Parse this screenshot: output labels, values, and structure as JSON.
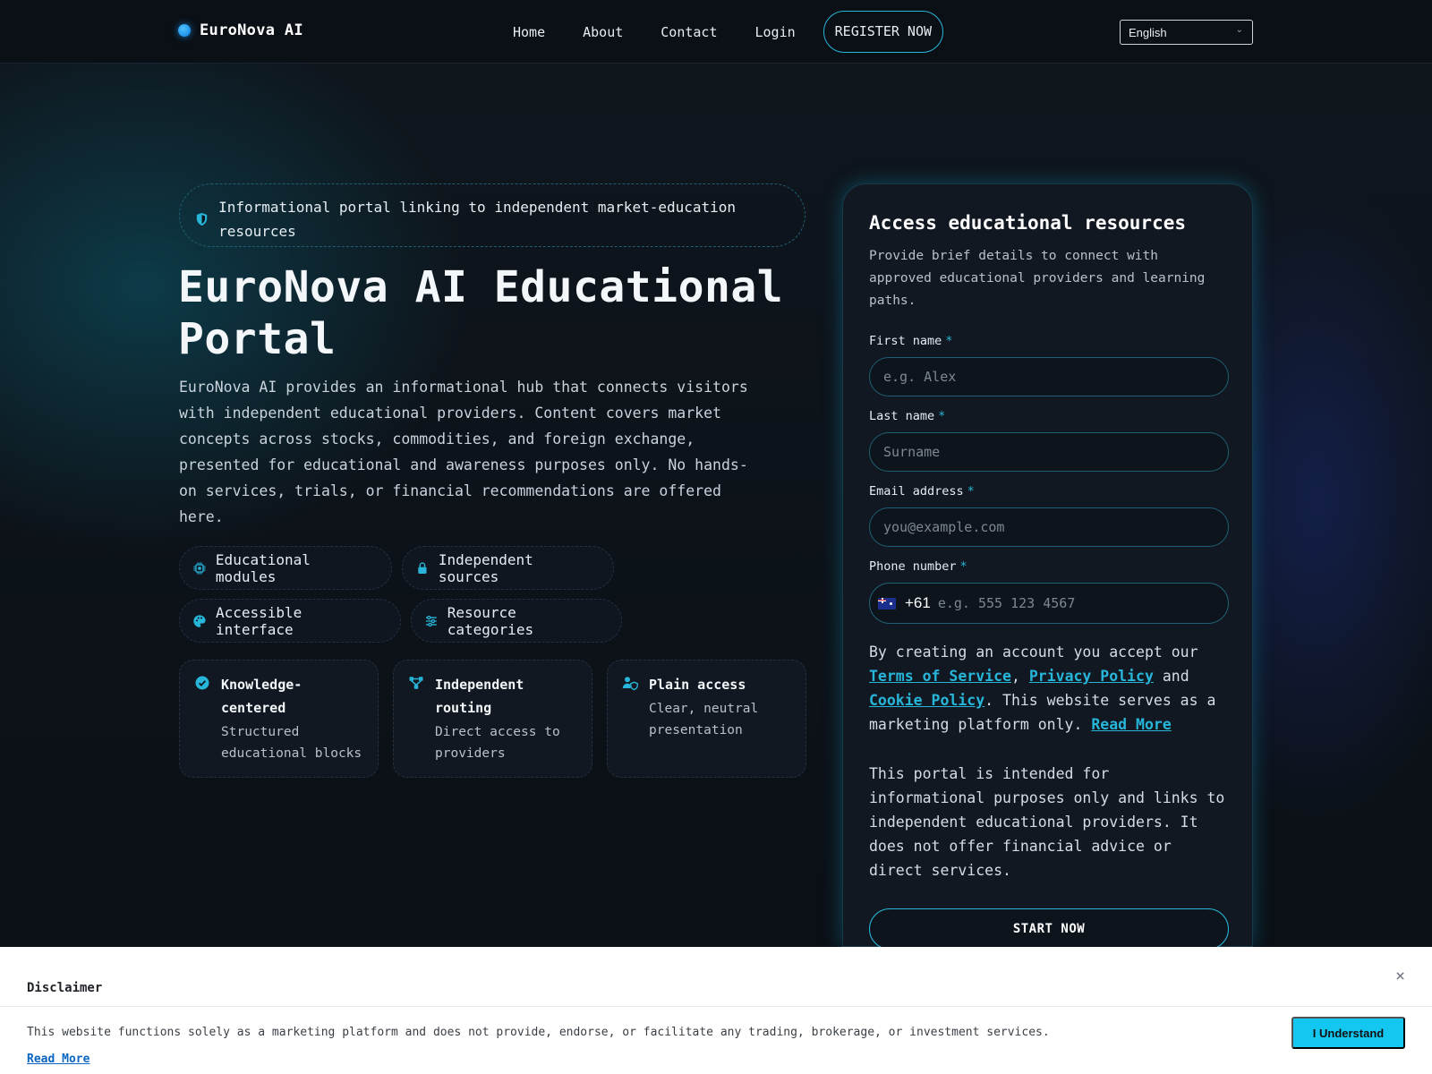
{
  "header": {
    "brand": "EuroNova AI",
    "nav": [
      "Home",
      "About",
      "Contact",
      "Login"
    ],
    "register_label": "REGISTER NOW",
    "language": "English"
  },
  "hero": {
    "badge": "Informational portal linking to independent market-education resources",
    "title": "EuroNova AI Educational Portal",
    "description": "EuroNova AI provides an informational hub that connects visitors with independent educational providers. Content covers market concepts across stocks, commodities, and foreign exchange, presented for educational and awareness purposes only. No hands-on services, trials, or financial recommendations are offered here.",
    "chips": [
      "Educational modules",
      "Independent sources",
      "Accessible interface",
      "Resource categories"
    ],
    "cards": [
      {
        "title": "Knowledge-centered",
        "desc": "Structured educational blocks"
      },
      {
        "title": "Independent routing",
        "desc": "Direct access to providers"
      },
      {
        "title": "Plain access",
        "desc": "Clear, neutral presentation"
      }
    ]
  },
  "form": {
    "title": "Access educational resources",
    "subtitle": "Provide brief details to connect with approved educational providers and learning paths.",
    "first_name_label": "First name",
    "first_name_placeholder": "e.g. Alex",
    "last_name_label": "Last name",
    "last_name_placeholder": "Surname",
    "email_label": "Email address",
    "email_placeholder": "you@example.com",
    "phone_label": "Phone number",
    "phone_dial": "+61",
    "phone_placeholder": "e.g. 555 123 4567",
    "required_mark": "*",
    "terms_prefix": "By creating an account you accept our",
    "terms_link": "Terms of Service",
    "privacy_link": "Privacy Policy",
    "and": "and",
    "cookie_link": "Cookie Policy",
    "terms_suffix": ". This website serves as a marketing platform only.",
    "read_more": "Read More",
    "notice": "This portal is intended for informational purposes only and links to independent educational providers. It does not offer financial advice or direct services.",
    "submit_label": "START NOW"
  },
  "disclaimer": {
    "title": "Disclaimer",
    "text": "This website functions solely as a marketing platform and does not provide, endorse, or facilitate any trading, brokerage, or investment services.",
    "read_more": "Read More",
    "button_label": "I Understand",
    "close": "×"
  },
  "colors": {
    "accent": "#27b6d9",
    "background": "#0d1118",
    "card": "#111821",
    "disclaimer_button": "#13c7f0"
  }
}
